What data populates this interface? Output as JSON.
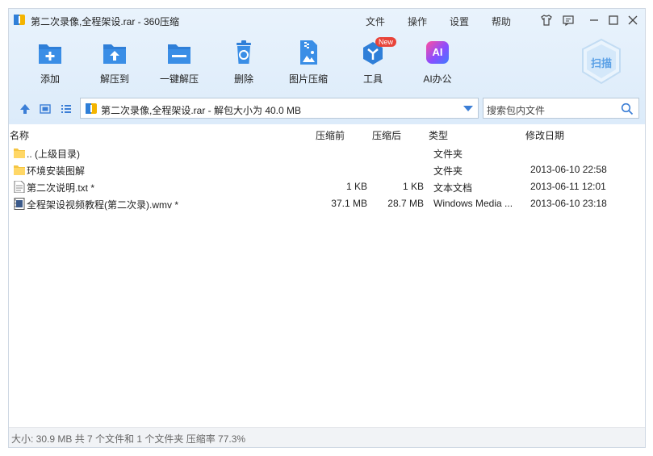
{
  "window": {
    "title": "第二次录像,全程架设.rar - 360压缩"
  },
  "menu": [
    "文件",
    "操作",
    "设置",
    "帮助"
  ],
  "toolbar": [
    {
      "label": "添加",
      "icon": "add-icon"
    },
    {
      "label": "解压到",
      "icon": "extract-to-icon"
    },
    {
      "label": "一键解压",
      "icon": "one-click-extract-icon"
    },
    {
      "label": "删除",
      "icon": "delete-icon"
    },
    {
      "label": "图片压缩",
      "icon": "image-compress-icon"
    },
    {
      "label": "工具",
      "icon": "tools-icon",
      "badge": "New"
    },
    {
      "label": "AI办公",
      "icon": "ai-office-icon",
      "glyph": "AI"
    }
  ],
  "scan": {
    "label": "扫描"
  },
  "nav": {
    "path": "第二次录像,全程架设.rar - 解包大小为 40.0 MB",
    "search_placeholder": "搜索包内文件"
  },
  "columns": {
    "name": "名称",
    "before": "压缩前",
    "after": "压缩后",
    "type": "类型",
    "modified": "修改日期"
  },
  "files": [
    {
      "name": ".. (上级目录)",
      "before": "",
      "after": "",
      "type": "文件夹",
      "modified": "",
      "icon": "folder-icon"
    },
    {
      "name": "环境安装图解",
      "before": "",
      "after": "",
      "type": "文件夹",
      "modified": "2013-06-10 22:58",
      "icon": "folder-icon"
    },
    {
      "name": "第二次说明.txt *",
      "before": "1 KB",
      "after": "1 KB",
      "type": "文本文档",
      "modified": "2013-06-11 12:01",
      "icon": "text-file-icon"
    },
    {
      "name": "全程架设视频教程(第二次录).wmv *",
      "before": "37.1 MB",
      "after": "28.7 MB",
      "type": "Windows Media ...",
      "modified": "2013-06-10 23:18",
      "icon": "video-file-icon"
    }
  ],
  "status": "大小: 30.9 MB 共 7 个文件和 1 个文件夹 压缩率 77.3%",
  "colors": {
    "accent": "#2f7fd8",
    "chrome_bg": "#dcebfa",
    "badge": "#e8443a"
  }
}
